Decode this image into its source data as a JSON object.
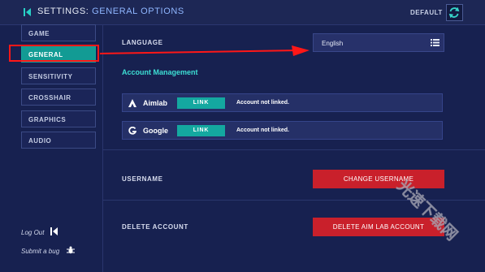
{
  "header": {
    "title_prefix": "SETTINGS:",
    "title_section": "GENERAL OPTIONS",
    "default_label": "DEFAULT",
    "icons": [
      "back-arrow-icon",
      "refresh-icon"
    ]
  },
  "sidebar": {
    "items": [
      {
        "label": "GAME",
        "active": false
      },
      {
        "label": "GENERAL",
        "active": true
      },
      {
        "label": "SENSITIVITY",
        "active": false
      },
      {
        "label": "CROSSHAIR",
        "active": false
      },
      {
        "label": "GRAPHICS",
        "active": false
      },
      {
        "label": "AUDIO",
        "active": false
      }
    ],
    "logout_label": "Log Out",
    "submit_bug_label": "Submit a bug"
  },
  "general": {
    "language_label": "LANGUAGE",
    "language_value": "English",
    "account_section_title": "Account Management",
    "accounts": [
      {
        "name": "Aimlab",
        "button": "LINK",
        "status": "Account not linked.",
        "icon": "aimlab-logo-icon"
      },
      {
        "name": "Google",
        "button": "LINK",
        "status": "Account not linked.",
        "icon": "google-logo-icon"
      }
    ],
    "username_label": "USERNAME",
    "change_username_button": "CHANGE USERNAME",
    "delete_account_label": "DELETE ACCOUNT",
    "delete_account_button": "DELETE AIM LAB ACCOUNT"
  },
  "colors": {
    "background": "#172150",
    "accent_teal": "#129b94",
    "danger_red": "#c9202b",
    "annotation_red": "#ff1717",
    "section_title": "#3ddfd4"
  },
  "watermark_text": "光速下载网"
}
